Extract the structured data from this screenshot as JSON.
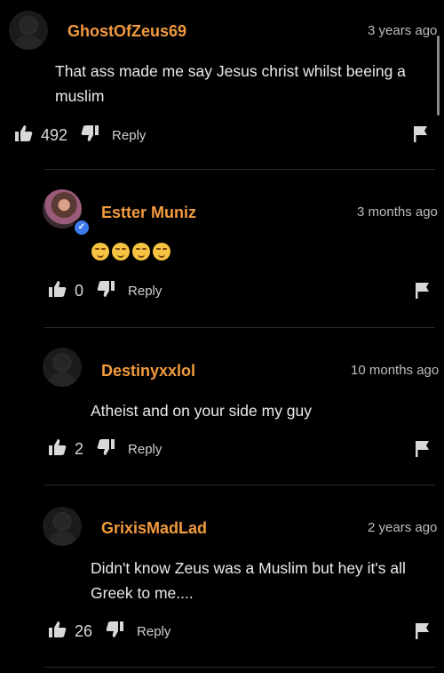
{
  "comments": [
    {
      "username": "GhostOfZeus69",
      "time": "3 years ago",
      "text": "That ass made me say Jesus christ whilst beeing a muslim",
      "likes": "492",
      "reply_label": "Reply",
      "avatar": "default-avatar-icon"
    },
    {
      "username": "Estter Muniz",
      "time": "3 months ago",
      "text": "",
      "emojis": [
        "relieved-face",
        "relieved-face",
        "relieved-face",
        "relieved-face"
      ],
      "likes": "0",
      "reply_label": "Reply",
      "avatar": "user-photo",
      "verified": true
    },
    {
      "username": "Destinyxxlol",
      "time": "10 months ago",
      "text": "Atheist and on your side my guy",
      "likes": "2",
      "reply_label": "Reply",
      "avatar": "default-avatar-icon"
    },
    {
      "username": "GrixisMadLad",
      "time": "2 years ago",
      "text": "Didn't know Zeus was a Muslim but hey it's all Greek to me....",
      "likes": "26",
      "reply_label": "Reply",
      "avatar": "default-avatar-icon"
    }
  ],
  "colors": {
    "background": "#000000",
    "username": "#f29a3e",
    "text": "#eaeaea",
    "verified": "#3d7bea"
  }
}
